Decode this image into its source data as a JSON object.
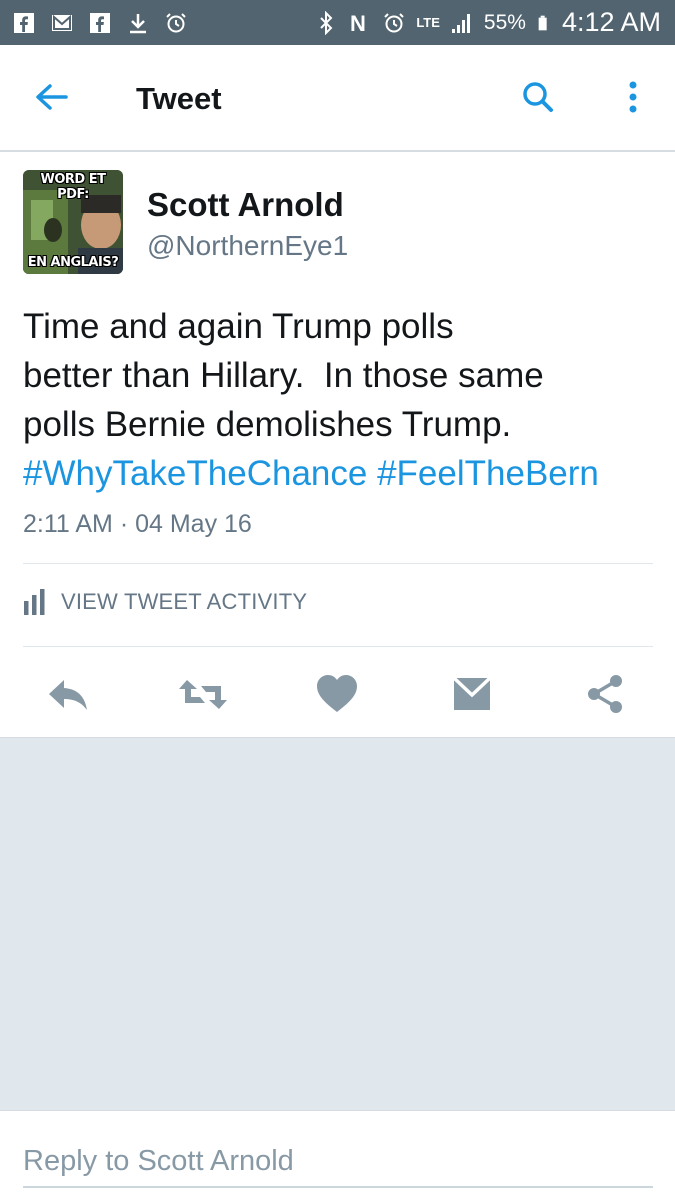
{
  "status_bar": {
    "battery_percent": "55%",
    "time": "4:12 AM",
    "network": "LTE"
  },
  "app_bar": {
    "title": "Tweet"
  },
  "tweet": {
    "author_name": "Scott Arnold",
    "author_handle": "@NorthernEye1",
    "avatar_text_top": "WORD ET PDF:",
    "avatar_text_bottom": "EN ANGLAIS?",
    "text_line_1": "Time and again Trump polls",
    "text_line_2": "better than Hillary.  In those same",
    "text_line_3": "polls Bernie demolishes Trump.",
    "hashtag_1": "#WhyTakeTheChance",
    "hashtag_2": "#FeelTheBern",
    "timestamp": "2:11 AM · 04 May 16",
    "activity_label": "VIEW TWEET ACTIVITY"
  },
  "reply": {
    "placeholder": "Reply to Scott Arnold"
  },
  "colors": {
    "accent": "#1b95e0",
    "status_bar": "#52646f",
    "action_icon": "#8899a6",
    "background": "#e1e8ed"
  }
}
